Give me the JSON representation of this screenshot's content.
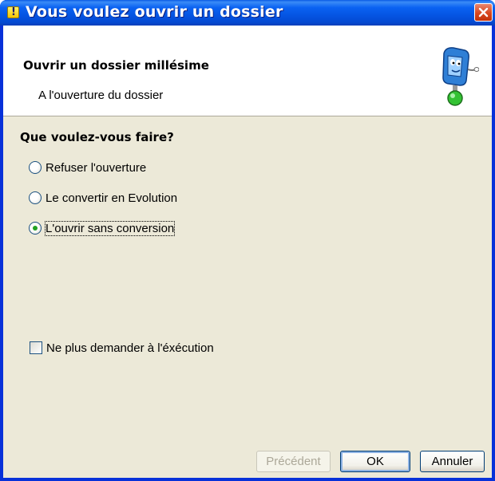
{
  "window": {
    "title": "Vous voulez ouvrir un dossier",
    "colors": {
      "titlebar": "#0a5ae4",
      "close": "#d8461e",
      "body": "#ece9d8",
      "selected_radio": "#21a121"
    }
  },
  "header": {
    "title": "Ouvrir un dossier millésime",
    "subtitle": "A l'ouverture du dossier"
  },
  "question": "Que voulez-vous faire?",
  "options": [
    {
      "label": "Refuser l'ouverture",
      "checked": false
    },
    {
      "label": "Le convertir en Evolution",
      "checked": false
    },
    {
      "label": "L'ouvrir sans conversion",
      "checked": true
    }
  ],
  "dont_ask": {
    "label": "Ne plus demander à l'éxécution",
    "checked": false
  },
  "buttons": {
    "previous": "Précédent",
    "ok": "OK",
    "cancel": "Annuler"
  }
}
